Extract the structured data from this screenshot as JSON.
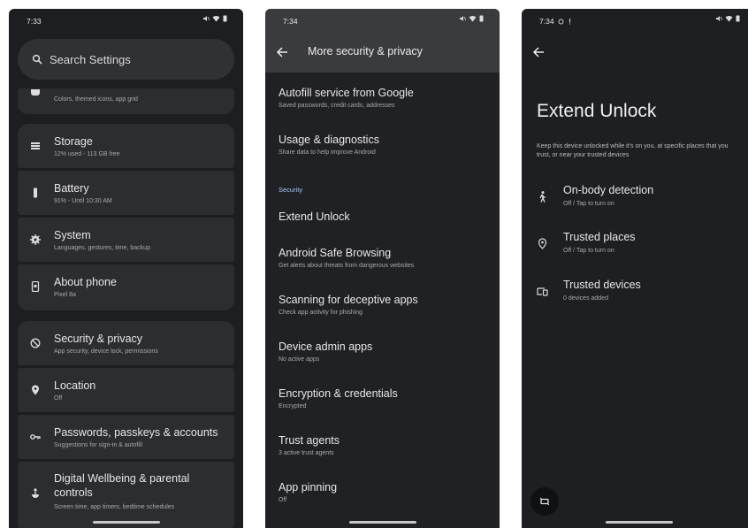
{
  "panel1": {
    "time": "7:33",
    "search_placeholder": "Search Settings",
    "wallpaper_subtitle": "Colors, themed icons, app grid",
    "items": [
      {
        "title": "Storage",
        "subtitle": "12% used - 113 GB free"
      },
      {
        "title": "Battery",
        "subtitle": "91% - Until 10:30 AM"
      },
      {
        "title": "System",
        "subtitle": "Languages, gestures, time, backup"
      },
      {
        "title": "About phone",
        "subtitle": "Pixel 8a"
      },
      {
        "title": "Security & privacy",
        "subtitle": "App security, device lock, permissions"
      },
      {
        "title": "Location",
        "subtitle": "Off"
      },
      {
        "title": "Passwords, passkeys & accounts",
        "subtitle": "Suggestions for sign-in & autofill"
      },
      {
        "title": "Digital Wellbeing & parental controls",
        "subtitle": "Screen time, app timers, bedtime schedules"
      }
    ]
  },
  "panel2": {
    "time": "7:34",
    "title": "More security & privacy",
    "section_label": "Security",
    "items": [
      {
        "title": "Autofill service from Google",
        "subtitle": "Saved passwords, credit cards, addresses"
      },
      {
        "title": "Usage & diagnostics",
        "subtitle": "Share data to help improve Android"
      },
      {
        "title": "Extend Unlock",
        "subtitle": ""
      },
      {
        "title": "Android Safe Browsing",
        "subtitle": "Get alerts about threats from dangerous websites"
      },
      {
        "title": "Scanning for deceptive apps",
        "subtitle": "Check app activity for phishing"
      },
      {
        "title": "Device admin apps",
        "subtitle": "No active apps"
      },
      {
        "title": "Encryption & credentials",
        "subtitle": "Encrypted"
      },
      {
        "title": "Trust agents",
        "subtitle": "3 active trust agents"
      },
      {
        "title": "App pinning",
        "subtitle": "Off"
      }
    ]
  },
  "panel3": {
    "time": "7:34",
    "title": "Extend Unlock",
    "description": "Keep this device unlocked while it's on you, at specific places that you trust, or near your trusted devices",
    "items": [
      {
        "title": "On-body detection",
        "subtitle": "Off / Tap to turn on",
        "icon": "walking-person-icon"
      },
      {
        "title": "Trusted places",
        "subtitle": "Off / Tap to turn on",
        "icon": "location-pin-icon"
      },
      {
        "title": "Trusted devices",
        "subtitle": "0 devices added",
        "icon": "devices-icon"
      }
    ]
  },
  "colors": {
    "background": "#1f2023",
    "card": "#2c2d31",
    "appbar": "#3a3b3f",
    "accent": "#a8c7fa"
  }
}
